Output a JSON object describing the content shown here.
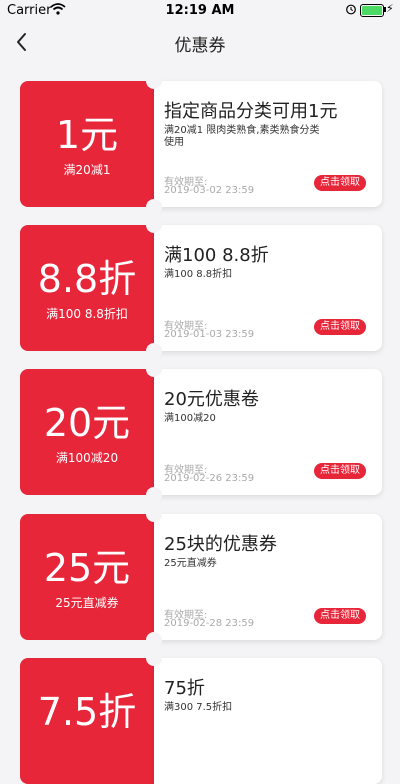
{
  "status_bar": {
    "carrier": "Carrier",
    "time": "12:19 AM"
  },
  "nav": {
    "title": "优惠券"
  },
  "colors": {
    "accent": "#e8263a",
    "background": "#f4f4f6"
  },
  "coupons": [
    {
      "amount": "1元",
      "condition": "满20减1",
      "title": "指定商品分类可用1元",
      "desc": "满20减1  限肉类熟食,素类熟食分类使用",
      "valid_label": "有效期至:",
      "valid_date": "2019-03-02 23:59",
      "claim": "点击领取"
    },
    {
      "amount": "8.8折",
      "condition": "满100 8.8折扣",
      "title": "满100 8.8折",
      "desc": "满100 8.8折扣",
      "valid_label": "有效期至:",
      "valid_date": "2019-01-03 23:59",
      "claim": "点击领取"
    },
    {
      "amount": "20元",
      "condition": "满100减20",
      "title": "20元优惠卷",
      "desc": "满100减20",
      "valid_label": "有效期至:",
      "valid_date": "2019-02-26 23:59",
      "claim": "点击领取"
    },
    {
      "amount": "25元",
      "condition": "25元直减券",
      "title": "25块的优惠券",
      "desc": "25元直减券",
      "valid_label": "有效期至:",
      "valid_date": "2019-02-28 23:59",
      "claim": "点击领取"
    },
    {
      "amount": "7.5折",
      "condition": "",
      "title": "75折",
      "desc": "满300 7.5折扣",
      "valid_label": "",
      "valid_date": "",
      "claim": ""
    }
  ]
}
